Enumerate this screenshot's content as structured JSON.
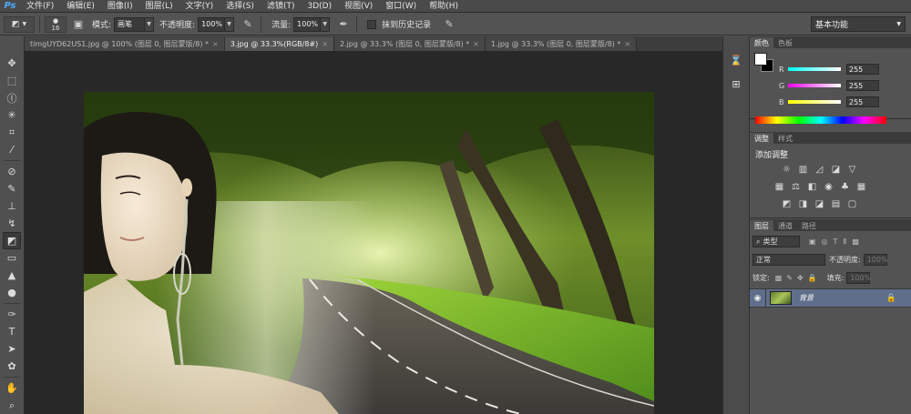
{
  "app": {
    "logo": "Ps"
  },
  "menu": [
    "文件(F)",
    "编辑(E)",
    "图像(I)",
    "图层(L)",
    "文字(Y)",
    "选择(S)",
    "滤镜(T)",
    "3D(D)",
    "视图(V)",
    "窗口(W)",
    "帮助(H)"
  ],
  "options": {
    "brush_size": "16",
    "mode_label": "模式:",
    "mode_value": "画笔",
    "opacity_label": "不透明度:",
    "opacity_value": "100%",
    "flow_label": "流量:",
    "flow_value": "100%",
    "erase_history_label": "抹到历史记录",
    "workspace": "基本功能"
  },
  "tabs": [
    {
      "label": "timgUYD62US1.jpg @ 100% (图层 0, 图层蒙版/8) *",
      "active": false
    },
    {
      "label": "3.jpg @ 33.3%(RGB/8#)",
      "active": true
    },
    {
      "label": "2.jpg @ 33.3% (图层 0, 图层蒙版/8) *",
      "active": false
    },
    {
      "label": "1.jpg @ 33.3% (图层 0, 图层蒙版/8) *",
      "active": false
    }
  ],
  "color_panel": {
    "tabs": [
      "颜色",
      "色板"
    ],
    "r": {
      "label": "R",
      "value": "255"
    },
    "g": {
      "label": "G",
      "value": "255"
    },
    "b": {
      "label": "B",
      "value": "255"
    },
    "foreground": "#ffffff",
    "background": "#000000"
  },
  "adjust_panel": {
    "tabs": [
      "调整",
      "样式"
    ],
    "title": "添加调整"
  },
  "layers_panel": {
    "tabs": [
      "图层",
      "通道",
      "路径"
    ],
    "filter_label": "类型",
    "blend_mode": "正常",
    "opacity_label": "不透明度:",
    "lock_label": "锁定:",
    "fill_label": "填充:",
    "opacity_value": "100%",
    "fill_value": "100%",
    "layer_name": "背景"
  },
  "colors": {
    "accent": "#4ea8ff",
    "selected_layer": "#5f6e8a",
    "canvas_bg": "#282828"
  }
}
